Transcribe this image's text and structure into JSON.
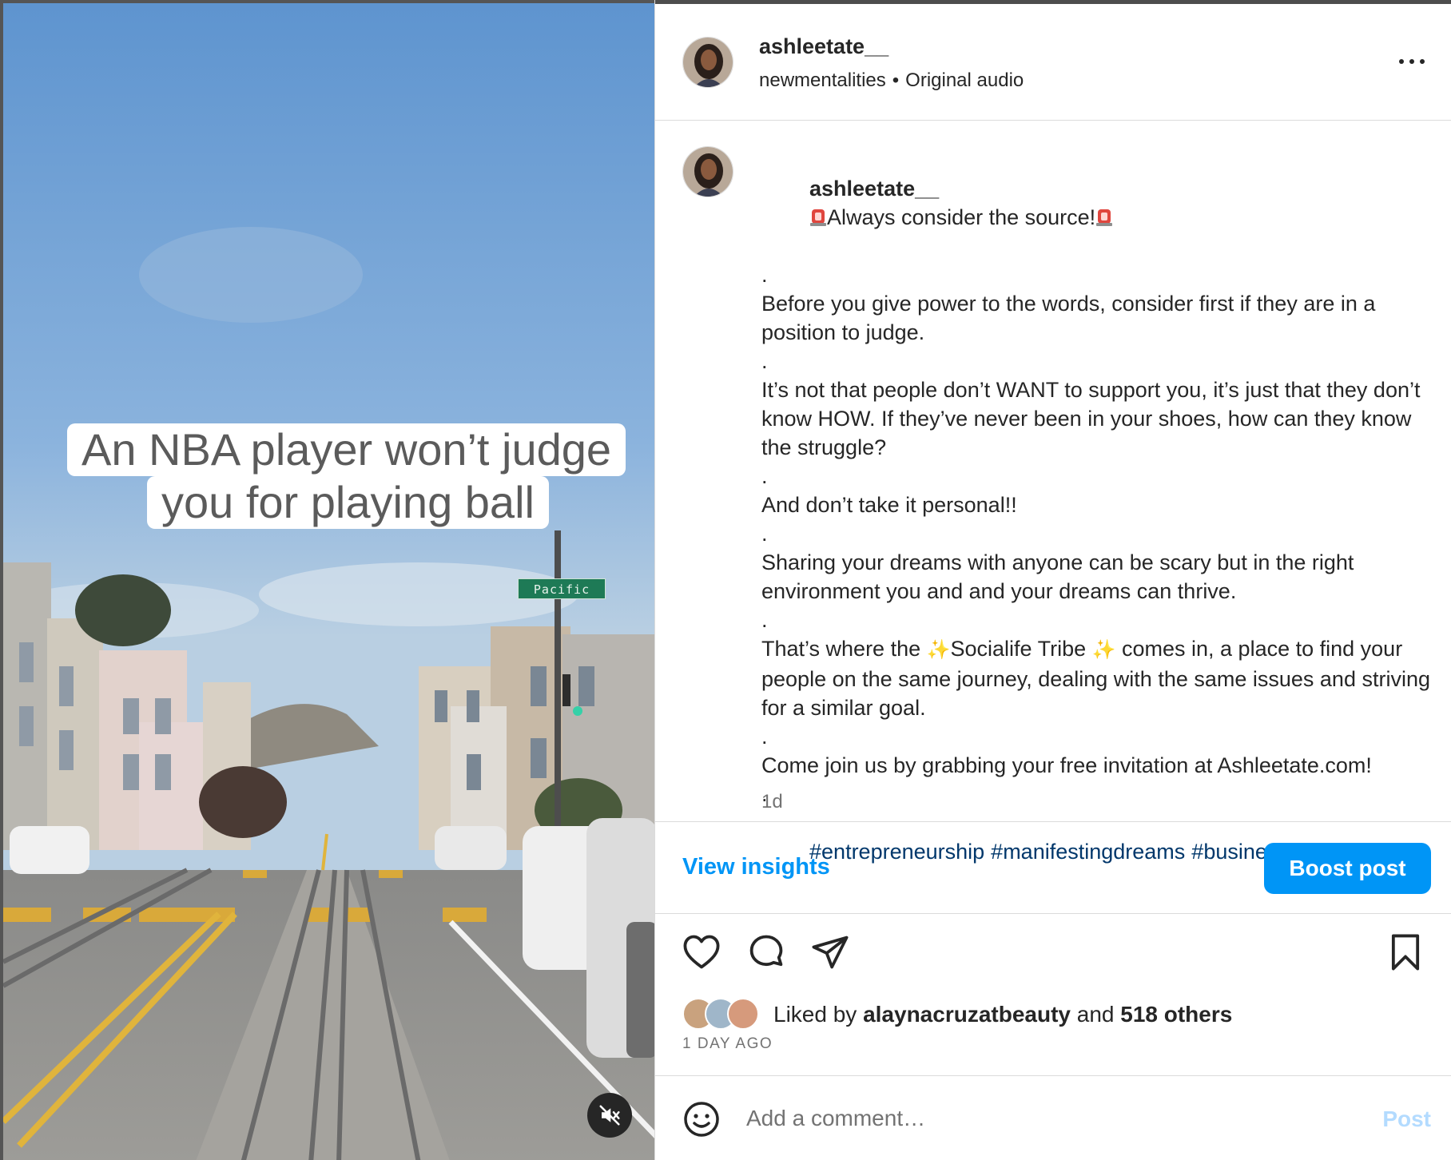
{
  "video": {
    "overlay_line1": "An NBA player won’t judge",
    "overlay_line2": "you for playing ball",
    "street_sign": "Pacific",
    "mute_icon": "speaker-muted-icon"
  },
  "header": {
    "username": "ashleetate__",
    "audio_author": "newmentalities",
    "separator": "•",
    "audio_label": "Original audio",
    "more_icon": "more-horizontal-icon"
  },
  "caption": {
    "username": "ashleetate__",
    "headline": "Always consider the source!",
    "dot": ".",
    "para1": "Before you give power to the words, consider first if they are in a position to judge.",
    "para2": "It’s not that people don’t WANT to support you, it’s just that they don’t know HOW. If they’ve never been in your shoes, how can they know the struggle?",
    "para3": "And don’t take it personal!!",
    "para4": "Sharing your dreams with anyone can be scary but in the right environment you and and your dreams can thrive.",
    "para5_before": "That’s where the ",
    "para5_tribe": "Socialife Tribe ",
    "para5_after": " comes in, a place to find your people on the same journey, dealing with the same issues and striving for a similar goal.",
    "para6": "Come join us by grabbing your free invitation at Ashleetate.com!",
    "hashtags": [
      "#entrepreneurship",
      "#manifestingdreams",
      "#businessmindset"
    ],
    "time_ago": "1d",
    "emoji_icons": [
      "siren-icon",
      "sparkles-icon"
    ]
  },
  "insights": {
    "view_insights": "View insights",
    "boost_post": "Boost post"
  },
  "actions": {
    "icons": [
      "heart-icon",
      "comment-icon",
      "share-icon",
      "bookmark-icon"
    ]
  },
  "likes": {
    "liked_by": "Liked by",
    "top_liker": "alaynacruzatbeauty",
    "and": "and",
    "others": "518 others",
    "date": "1 DAY AGO"
  },
  "comment": {
    "placeholder": "Add a comment…",
    "post_label": "Post",
    "emoji_icon": "emoji-face-icon"
  },
  "colors": {
    "accent": "#0095f6",
    "hashtag": "#00376b",
    "muted_text": "#737373",
    "post_disabled": "#b3dbff"
  }
}
